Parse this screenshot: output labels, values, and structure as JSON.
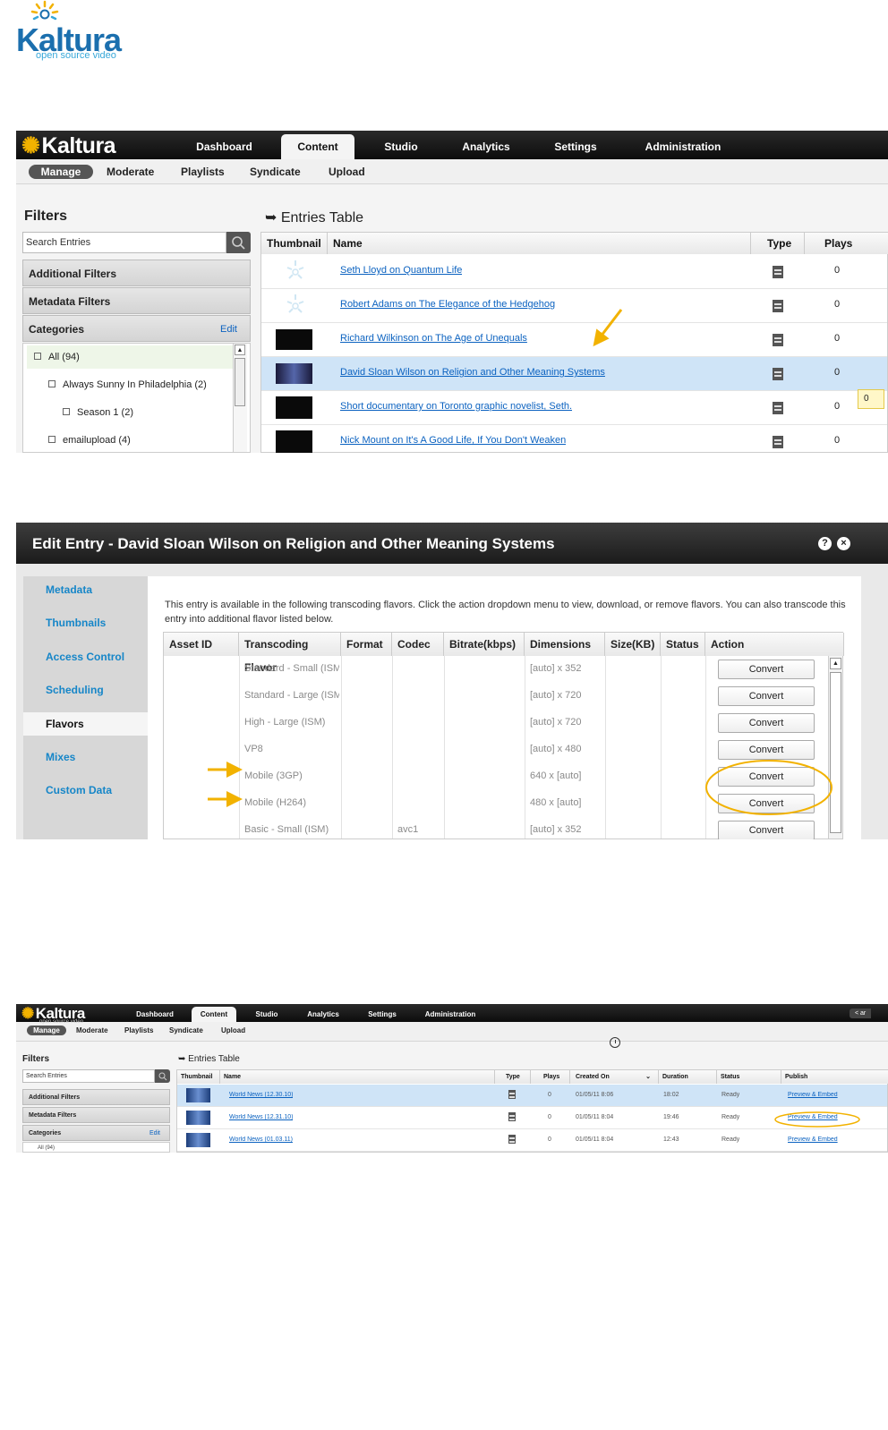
{
  "logo": {
    "word": "Kaltura",
    "tagline": "open source video"
  },
  "panel1": {
    "nav_logo": "Kaltura",
    "tabs": [
      "Dashboard",
      "Content",
      "Studio",
      "Analytics",
      "Settings",
      "Administration"
    ],
    "active_tab": "Content",
    "subtabs": [
      "Manage",
      "Moderate",
      "Playlists",
      "Syndicate",
      "Upload"
    ],
    "filters_title": "Filters",
    "search_placeholder": "Search Entries",
    "additional_filters": "Additional Filters",
    "metadata_filters": "Metadata Filters",
    "categories_label": "Categories",
    "categories_edit": "Edit",
    "categories": [
      {
        "label": "All  (94)"
      },
      {
        "label": "Always Sunny In Philadelphia  (2)"
      },
      {
        "label": "Season 1  (2)"
      },
      {
        "label": "emailupload  (4)"
      }
    ],
    "entries_title": "Entries Table",
    "columns": [
      "Thumbnail",
      "Name",
      "Type",
      "Plays"
    ],
    "rows": [
      {
        "name": "Seth Lloyd on Quantum Life",
        "plays": "0"
      },
      {
        "name": "Robert Adams on The Elegance of the Hedgehog",
        "plays": "0"
      },
      {
        "name": "Richard Wilkinson on The Age of Unequals",
        "plays": "0"
      },
      {
        "name": "David Sloan Wilson on Religion and Other Meaning Systems",
        "plays": "0"
      },
      {
        "name": "Short documentary on Toronto graphic novelist, Seth.",
        "plays": "0"
      },
      {
        "name": "Nick Mount on It's A Good Life, If You Don't Weaken",
        "plays": "0"
      }
    ],
    "tooltip": "0"
  },
  "panel2": {
    "title": "Edit Entry - David Sloan Wilson on Religion and Other Meaning Systems",
    "help_icon": "?",
    "close_icon": "×",
    "side_items": [
      "Metadata",
      "Thumbnails",
      "Access Control",
      "Scheduling",
      "Flavors",
      "Mixes",
      "Custom Data"
    ],
    "active_side": "Flavors",
    "intro": "This entry is available in the following transcoding flavors. Click the action dropdown menu to view, download, or remove flavors. You can also transcode this entry into additional flavor listed below.",
    "columns": [
      "Asset ID",
      "Transcoding Flavor",
      "Format",
      "Codec",
      "Bitrate(kbps)",
      "Dimensions",
      "Size(KB)",
      "Status",
      "Action"
    ],
    "rows": [
      {
        "flavor": "Standard - Small (ISM)",
        "codec": "",
        "dimensions": "[auto] x 352",
        "action": "Convert"
      },
      {
        "flavor": "Standard - Large (ISM)",
        "codec": "",
        "dimensions": "[auto] x 720",
        "action": "Convert"
      },
      {
        "flavor": "High - Large (ISM)",
        "codec": "",
        "dimensions": "[auto] x 720",
        "action": "Convert"
      },
      {
        "flavor": "VP8",
        "codec": "",
        "dimensions": "[auto] x 480",
        "action": "Convert"
      },
      {
        "flavor": "Mobile (3GP)",
        "codec": "",
        "dimensions": "640 x [auto]",
        "action": "Convert"
      },
      {
        "flavor": "Mobile (H264)",
        "codec": "",
        "dimensions": "480 x [auto]",
        "action": "Convert"
      },
      {
        "flavor": "Basic - Small (ISM)",
        "codec": "avc1",
        "dimensions": "[auto] x 352",
        "action": "Convert"
      }
    ]
  },
  "panel3": {
    "nav_logo": "Kaltura",
    "nav_tagline": "open source video",
    "tabs": [
      "Dashboard",
      "Content",
      "Studio",
      "Analytics",
      "Settings",
      "Administration"
    ],
    "right_button": "< ar",
    "subtabs": [
      "Manage",
      "Moderate",
      "Playlists",
      "Syndicate",
      "Upload"
    ],
    "filters_title": "Filters",
    "search_placeholder": "Search Entries",
    "additional_filters": "Additional Filters",
    "metadata_filters": "Metadata Filters",
    "categories_label": "Categories",
    "categories_edit": "Edit",
    "category_first": "All  (94)",
    "entries_title": "Entries Table",
    "columns": [
      "Thumbnail",
      "Name",
      "Type",
      "Plays",
      "Created On",
      "Duration",
      "Status",
      "Publish"
    ],
    "rows": [
      {
        "name": "World News (12.30.10)",
        "plays": "0",
        "created": "01/05/11 8:06",
        "duration": "18:02",
        "status": "Ready",
        "publish": "Preview & Embed"
      },
      {
        "name": "World News (12.31.10)",
        "plays": "0",
        "created": "01/05/11 8:04",
        "duration": "19:46",
        "status": "Ready",
        "publish": "Preview & Embed"
      },
      {
        "name": "World News (01.03.11)",
        "plays": "0",
        "created": "01/05/11 8:04",
        "duration": "12:43",
        "status": "Ready",
        "publish": "Preview & Embed"
      }
    ]
  },
  "colors": {
    "brand_blue": "#1b6fae",
    "link": "#0b62c0",
    "selected_row": "#cfe4f7",
    "annotation": "#f2b200"
  }
}
